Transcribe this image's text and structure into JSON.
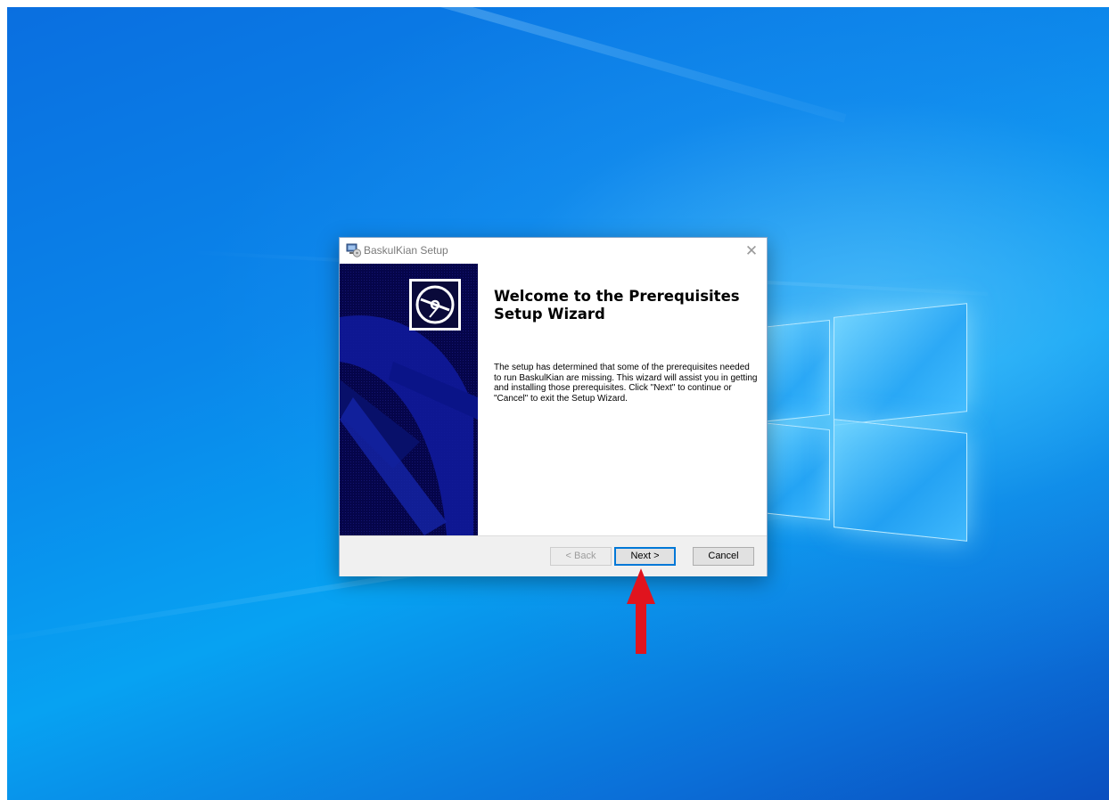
{
  "dialog": {
    "title": "BaskulKian Setup",
    "close_glyph": "✕",
    "heading": "Welcome to the Prerequisites Setup Wizard",
    "description": "The setup has determined that some of the prerequisites needed to run BaskulKian are missing. This wizard will assist you in getting and installing those prerequisites. Click \"Next\" to continue or \"Cancel\" to exit the Setup Wizard.",
    "buttons": {
      "back_label": "< Back",
      "next_label": "Next >",
      "cancel_label": "Cancel"
    },
    "back_enabled": false,
    "focused_button": "next"
  },
  "icons": {
    "title_icon": "setup-computer-icon",
    "banner_icon": "cd-disc-icon"
  },
  "annotation": {
    "arrow_color": "#e0141e",
    "points_to": "next-button"
  }
}
